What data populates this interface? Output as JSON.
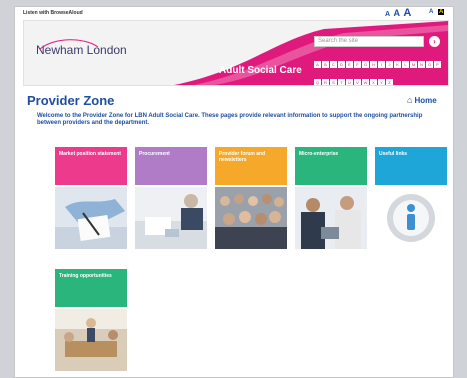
{
  "topbar": {
    "listen_label": "Listen with BrowseAloud",
    "text_size": [
      "A",
      "A",
      "A"
    ],
    "contrast": [
      "A",
      "A"
    ]
  },
  "header": {
    "logo_text": "Newham London",
    "section_title": "Adult Social Care",
    "search_placeholder": "Search the site",
    "search_button": "›",
    "az_letters": [
      "A",
      "B",
      "C",
      "D",
      "E",
      "F",
      "G",
      "H",
      "I",
      "J",
      "K",
      "L",
      "M",
      "N",
      "O",
      "P",
      "Q",
      "R",
      "S",
      "T",
      "U",
      "V",
      "W",
      "X",
      "Y",
      "Z"
    ]
  },
  "main": {
    "title": "Provider Zone",
    "home_label": "Home",
    "intro": "Welcome to the Provider Zone for LBN Adult Social Care. These pages provide relevant information to support the ongoing partnership between providers and the department.",
    "tiles": [
      {
        "label": "Market position statement",
        "color": "#ee3a8c"
      },
      {
        "label": "Procurement",
        "color": "#b07cc8"
      },
      {
        "label": "Provider forum and newsletters",
        "color": "#f6a82b"
      },
      {
        "label": "Micro-enterprise",
        "color": "#2ab57d"
      },
      {
        "label": "Useful links",
        "color": "#1ea6d8"
      },
      {
        "label": "Training opportunities",
        "color": "#2ab57d"
      }
    ]
  },
  "colors": {
    "brand_pink": "#e0197d",
    "link_blue": "#1f4fa3"
  }
}
